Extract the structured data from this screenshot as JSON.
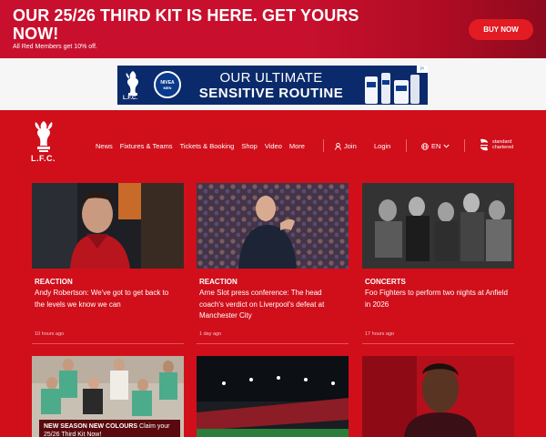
{
  "promo": {
    "title": "OUR 25/26 THIRD KIT IS HERE. GET YOURS NOW!",
    "subtitle": "All Red Members get 10% off.",
    "button": "BUY NOW"
  },
  "ad": {
    "brand_top": "NIVEA",
    "brand_bottom": "MEN",
    "club": "L.F.C.",
    "line1": "OUR ULTIMATE",
    "line2": "SENSITIVE ROUTINE",
    "info": "i×"
  },
  "nav": {
    "crest_text": "L.F.C.",
    "items": [
      "News",
      "Fixtures & Teams",
      "Tickets & Booking",
      "Shop",
      "Video",
      "More"
    ],
    "join": "Join",
    "login": "Login",
    "lang": "EN",
    "sponsor_line1": "standard",
    "sponsor_line2": "chartered"
  },
  "cards": [
    {
      "tag": "REACTION",
      "title": "Andy Robertson: We've got to get back to the levels we know we can",
      "time": "10 hours ago"
    },
    {
      "tag": "REACTION",
      "title": "Arne Slot press conference: The head coach's verdict on Liverpool's defeat at Manchester City",
      "time": "1 day ago"
    },
    {
      "tag": "CONCERTS",
      "title": "Foo Fighters to perform two nights at Anfield in 2026",
      "time": "17 hours ago"
    }
  ],
  "row2": {
    "label_bold": "NEW SEASON NEW COLOURS",
    "label_rest": "Claim your 25/26 Third Kit Now!"
  },
  "colors": {
    "brand_red": "#d00f1b",
    "button_red": "#e31b23",
    "ad_blue": "#0b2a6b"
  }
}
